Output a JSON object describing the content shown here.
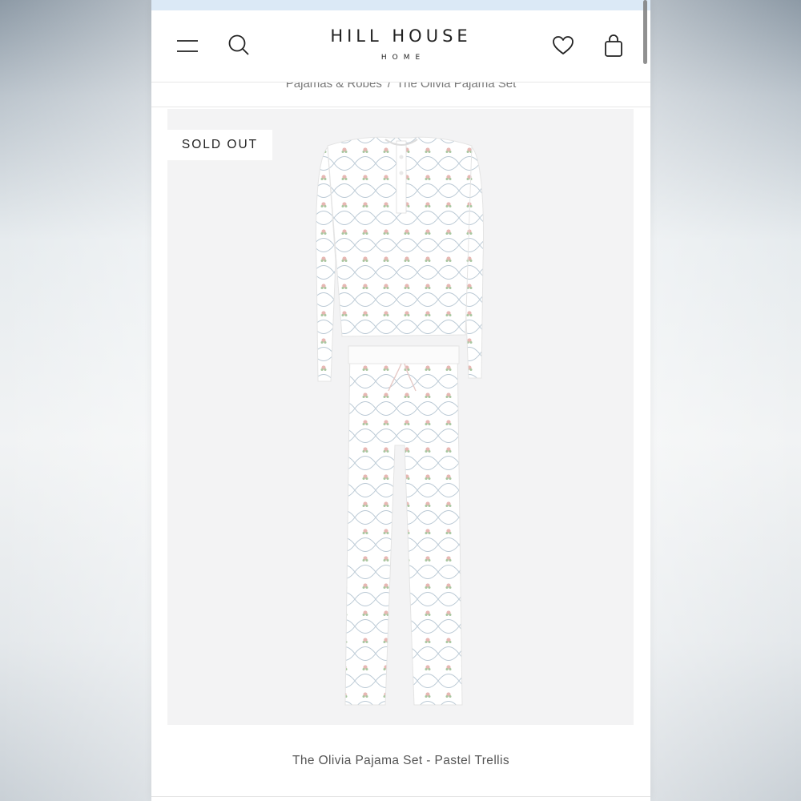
{
  "brand": {
    "name": "HILL HOUSE",
    "sub": "HOME"
  },
  "header": {
    "icons": [
      "menu-icon",
      "search-icon",
      "heart-icon",
      "bag-icon"
    ]
  },
  "breadcrumb": {
    "items": [
      "Pajamas & Robes",
      "The Olivia Pajama Set"
    ],
    "separator": "/"
  },
  "product": {
    "badge": "SOLD OUT",
    "title": "The Olivia Pajama Set - Pastel Trellis"
  },
  "colors": {
    "top_strip": "#dbe9f6",
    "image_bg": "#f3f3f4",
    "text": "#222222",
    "muted": "#777777"
  }
}
